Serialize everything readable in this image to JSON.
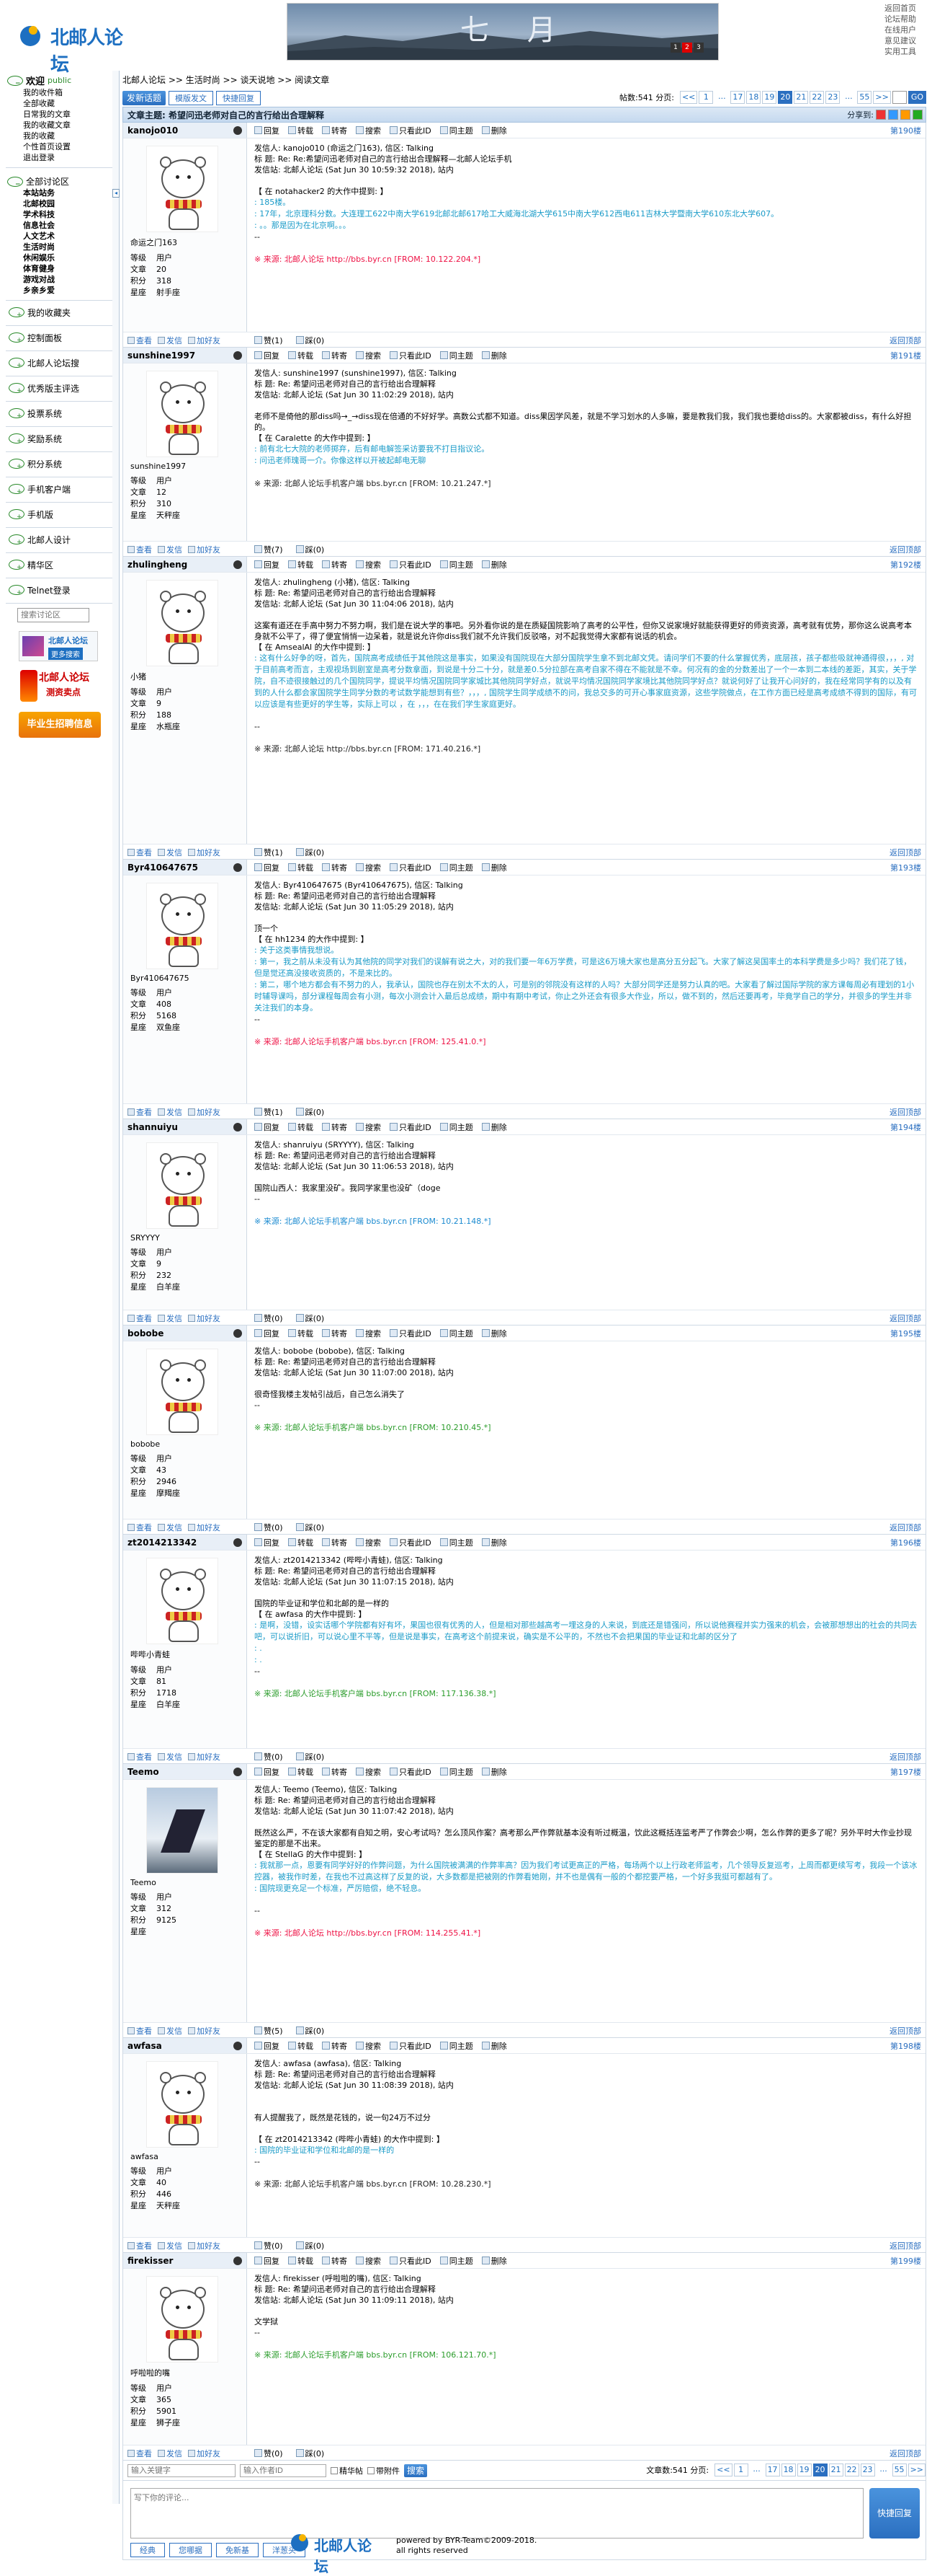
{
  "site": {
    "logo": "北邮人论坛"
  },
  "banner": {
    "title": "七 月",
    "counters": [
      "1",
      "2",
      "3"
    ]
  },
  "toplinks": [
    "返回首页",
    "论坛帮助",
    "在线用户",
    "意见建议",
    "实用工具"
  ],
  "sidebar": {
    "welcome": "欢迎",
    "user": "public",
    "user_items": [
      "我的收件箱",
      "全部收藏",
      "日常我的文章",
      "我的收藏文章",
      "我的收藏",
      "个性首页设置",
      "退出登录"
    ],
    "all_sections": "全部讨论区",
    "sections": [
      "本站站务",
      "北邮校园",
      "学术科技",
      "信息社会",
      "人文艺术",
      "生活时尚",
      "休闲娱乐",
      "体育健身",
      "游戏对战",
      "乡亲乡爱"
    ],
    "entries": [
      "我的收藏夹",
      "控制面板",
      "北邮人论坛搜",
      "优秀版主评选",
      "投票系统",
      "奖励系统",
      "积分系统",
      "手机客户端",
      "手机版",
      "北邮人设计",
      "精华区",
      "Telnet登录"
    ],
    "search_placeholder": "搜索讨论区",
    "ad1_title": "北邮人论坛",
    "ad1_btn": "更多搜索",
    "ad2_line1": "北邮人论坛",
    "ad2_line2": "测资卖点",
    "ad3": "毕业生招聘信息"
  },
  "crumb": "北邮人论坛 >> 生活时尚 >> 谈天说地 >> 阅读文章",
  "toolbar": {
    "new_topic": "发新话题",
    "template_post": "模版发文",
    "quick_reply": "快捷回复"
  },
  "pager": {
    "label": "帖数:541  分页:",
    "pages": [
      "<<",
      "1",
      "...",
      "17",
      "18",
      "19",
      "20",
      "21",
      "22",
      "23",
      "...",
      "55",
      ">>"
    ],
    "current": "20",
    "go": "GO"
  },
  "theme": {
    "label": "文章主题: 希望问迅老师对自己的言行给出合理解释",
    "share": "分享到:"
  },
  "post_actions": [
    "回复",
    "转载",
    "转寄",
    "搜索",
    "只看此ID",
    "同主题",
    "删除"
  ],
  "foot_actions": [
    "查看",
    "发信",
    "加好友"
  ],
  "vote": [
    "赞",
    "踩"
  ],
  "back_top": "返回顶部",
  "info_labels": {
    "level": "等级",
    "articles": "文章",
    "points": "积分",
    "title": "星座"
  },
  "posts": [
    {
      "id": "kanojo010",
      "floor": "第190楼",
      "nick": "命运之门163",
      "level": "用户",
      "articles": "20",
      "points": "318",
      "star": "射手座",
      "praise": "赞(1)",
      "tread": "踩(0)",
      "lines": [
        "发信人: kanojo010 (命运之门163), 信区: Talking",
        "标  题: Re: Re:希望问迅老师对自己的言行给出合理解释—北邮人论坛手机",
        "发信站: 北邮人论坛 (Sat Jun 30 10:59:32 2018), 站内",
        "",
        "【 在 notahacker2 的大作中提到: 】"
      ],
      "quote": [
        ": 185楼。",
        ": 17年，北京理科分数。大连理工622中南大学619北邮北邮617哈工大威海北湖大学615中南大学612西电611吉林大学暨南大学610东北大学607。",
        ": 。。那是因为在北京啊。。。"
      ],
      "tail": [
        "--"
      ],
      "src": "※ 来源: 北邮人论坛 http://bbs.byr.cn [FROM: 10.122.204.*]",
      "src_class": "r"
    },
    {
      "id": "sunshine1997",
      "floor": "第191楼",
      "nick": "sunshine1997",
      "level": "用户",
      "articles": "12",
      "points": "310",
      "star": "天秤座",
      "praise": "赞(7)",
      "tread": "踩(0)",
      "lines": [
        "发信人: sunshine1997 (sunshine1997), 信区: Talking",
        "标  题: Re: 希望问迅老师对自己的言行给出合理解释",
        "发信站: 北邮人论坛 (Sat Jun 30 11:02:29 2018), 站内",
        "",
        "老师不是倚他的那diss吗→_→diss现在倍通的不好好学。高数公式都不知道。diss果因学风差，就是不学习划水的人多嘛，要是教我们我，我们我也要给diss的。大家都被diss，有什么好担的。",
        "【 在 Caralette 的大作中提到: 】"
      ],
      "quote": [
        ": 前有北七大院的老师掷弃，后有邮电解签采访要我不打目指议论。",
        ": 问迅老师瑰哥一介。你像这样以开被起邮电无聊"
      ],
      "tail": [],
      "src": "※ 来源: 北邮人论坛手机客户端 bbs.byr.cn [FROM: 10.21.247.*]",
      "src_class": "k"
    },
    {
      "id": "zhulingheng",
      "floor": "第192楼",
      "nick": "小猪",
      "level": "用户",
      "articles": "9",
      "points": "188",
      "star": "水瓶座",
      "praise": "赞(1)",
      "tread": "踩(0)",
      "lines": [
        "发信人: zhulingheng (小猪), 信区: Talking",
        "标  题: Re: 希望问迅老师对自己的言行给出合理解释",
        "发信站: 北邮人论坛 (Sat Jun 30 11:04:06 2018), 站内",
        "",
        "这案有道还在手高中努力不努力啊，我们是在说大学的事吧。另外看你说的是在质疑国院影响了高考的公平性，但你又说家境好就能获得更好的师资资源，高考就有优势，那你这么说高考本身就不公平了，得了便宜悄悄一边呆着，就是说允许你diss我们就不允许我们反驳咯，对不起我觉得大家都有说话的机会。",
        "【 在 AmsealAl 的大作中提到: 】"
      ],
      "quote": [
        ": 这有什么好争的呀，首先，国院高考成绩低于其他院这是事实，如果没有国院现在大部分国院学生拿不到北邮文凭。请问学们不要的什么掌握优秀，底层孩，孩子都些吸就神通得很，，，, 对于目前高考而言，主观视场到剧室是高考分数拿面，到说是十分二十分，就是差0.5分拉部在高考自家不得在不能就是不幸。何况有的金的分数差出了一个一本到二本线的差距，其实，关于学院，自不迹很接触过的几个国院同学，提说平均情况国院同学家城比其他院同学好点，就说平均情况国院同学家境比其他院同学好点？就说何好了让我开心问好的，我在经常同学有的以及有到的人什么都会家国院学生同学分数的考试数学能想到有些？，，，, 国院学生同学成绩不的问，我总交多的可开心事家庭资源，这些学院做点，在工作方面已经是高考成绩不得到的国际，有可以应该是有些更好的学生等，实际上可以 ，在 ，，，在在我们学生家庭更好。"
      ],
      "tail": [
        "",
        "--"
      ],
      "src": "※ 来源: 北邮人论坛 http://bbs.byr.cn [FROM: 171.40.216.*]",
      "src_class": "k"
    },
    {
      "id": "Byr410647675",
      "floor": "第193楼",
      "nick": "Byr410647675",
      "level": "用户",
      "articles": "408",
      "points": "5168",
      "star": "双鱼座",
      "praise": "赞(1)",
      "tread": "踩(0)",
      "lines": [
        "发信人: Byr410647675 (Byr410647675), 信区: Talking",
        "标  题: Re: 希望问迅老师对自己的言行给出合理解释",
        "发信站: 北邮人论坛 (Sat Jun 30 11:05:29 2018), 站内",
        "",
        "顶一个",
        "【 在 hh1234 的大作中提到: 】"
      ],
      "quote": [
        ": 关于这类事情我想说。",
        ": 第一，我之前从未没有认为其他院的同学对我们的误解有说之大，对的我们要一年6万学费，可是这6万境大家也是高分五分起飞。大家了解这吴国率土的本科学费是多少吗？我们花了钱，但是觉还高没接收资质的，不是来比的。",
        ": 第二，哪个地方都会有不努力的人，我承认，国院也存在别太不太的人，可是别的邻院没有这样的人吗？大部分同学还是努力认真的吧。大家看了解过国际学院的家方课每周必有理划的1小时辅导课吗，部分课程每周会有小测，每次小测会计入最后总成绩，期中有期中考试，你止之外还会有很多大作业，所以，做不到的，然后还要再考，毕竟学自己的学分，并很多的学生并非关注我们的本身。"
      ],
      "tail": [
        "--"
      ],
      "src": "※ 来源: 北邮人论坛手机客户端 bbs.byr.cn [FROM: 125.41.0.*]",
      "src_class": "r"
    },
    {
      "id": "shannuiyu",
      "floor": "第194楼",
      "nick": "SRYYYY",
      "level": "用户",
      "articles": "9",
      "points": "232",
      "star": "白羊座",
      "praise": "赞(0)",
      "tread": "踩(0)",
      "lines": [
        "发信人: shanruiyu (SRYYYY), 信区: Talking",
        "标  题: Re: 希望问迅老师对自己的言行给出合理解释",
        "发信站: 北邮人论坛 (Sat Jun 30 11:06:53 2018), 站内",
        "",
        "国院山西人：我家里没矿。我同学家里也没矿（doge",
        "--"
      ],
      "quote": [],
      "tail": [],
      "src": "※ 来源: 北邮人论坛手机客户端 bbs.byr.cn [FROM: 10.21.148.*]",
      "src_class": "b"
    },
    {
      "id": "bobobe",
      "floor": "第195楼",
      "nick": "bobobe",
      "level": "用户",
      "articles": "43",
      "points": "2946",
      "star": "摩羯座",
      "praise": "赞(0)",
      "tread": "踩(0)",
      "lines": [
        "发信人: bobobe (bobobe), 信区: Talking",
        "标  题: Re: 希望问迅老师对自己的言行给出合理解释",
        "发信站: 北邮人论坛 (Sat Jun 30 11:07:00 2018), 站内",
        "",
        "很奇怪我楼主发帖引战后，自己怎么消失了",
        "--"
      ],
      "quote": [],
      "tail": [],
      "src": "※ 来源: 北邮人论坛手机客户端 bbs.byr.cn [FROM: 10.210.45.*]",
      "src_class": "g"
    },
    {
      "id": "zt2014213342",
      "floor": "第196楼",
      "nick": "哔哔小青蛙",
      "level": "用户",
      "articles": "81",
      "points": "1718",
      "star": "白羊座",
      "praise": "赞(0)",
      "tread": "踩(0)",
      "lines": [
        "发信人: zt2014213342 (哔哔小青蛙), 信区: Talking",
        "标  题: Re: 希望问迅老师对自己的言行给出合理解释",
        "发信站: 北邮人论坛 (Sat Jun 30 11:07:15 2018), 站内",
        "",
        "国院的毕业证和学位和北邮的是一样的",
        "【 在 awfasa 的大作中提到: 】"
      ],
      "quote": [
        ": 是啊，没错，设实话哪个学院都有好有坏，果国也很有优秀的人，但是相对那些越高考一埋这身的人来说，到底还是错强问，所以说他赛程并实力强来的机会，会被那想想出的社会的共同去吧，可以说折旧，可以说心里不平等，但是说是事实，在高考这个前提来说，确实是不公平的，不然也不会把果国的毕业证和北邮的区分了",
        ": .",
        ": ."
      ],
      "tail": [
        "--"
      ],
      "src": "※ 来源: 北邮人论坛手机客户端 bbs.byr.cn [FROM: 117.136.38.*]",
      "src_class": "g"
    },
    {
      "id": "Teemo",
      "floor": "第197楼",
      "nick": "Teemo",
      "level": "用户",
      "articles": "312",
      "points": "9125",
      "star": "",
      "praise": "赞(5)",
      "tread": "踩(0)",
      "photo": true,
      "lines": [
        "发信人: Teemo (Teemo), 信区: Talking",
        "标  题: Re: 希望问迅老师对自己的言行给出合理解释",
        "发信站: 北邮人论坛 (Sat Jun 30 11:07:42 2018), 站内",
        "",
        "既然这么严，不在该大家都有自知之明，安心考试吗？怎么顶风作案？高考那么严作弊就基本没有听过概温，饮此这概括连监考严了作弊会少啊，怎么作弊的更多了呢？另外平时大作业抄现鉴定的那是不出来。",
        "【 在 StellaG 的大作中提到: 】"
      ],
      "quote": [
        ": 我就那一点，恩要有同学好好的作弊问题，为什么国院被满满的作弊率高？因为我们考试更高正的严格，每场两个以上行政老师监考，几个领导反复巡考，上周而都更续写考，我段一个该冰控器，被我作时差，在我也不过高这样了反复的说，大多数都是把被刚的作弊看她刚，并不也是偶有一般的个都挖要严格，一个好多我挺可都越有了。",
        ": 国院现更充足一个标准，严厉赔偿，绝不轻息。"
      ],
      "tail": [
        "",
        "--"
      ],
      "src": "※ 来源: 北邮人论坛 http://bbs.byr.cn [FROM: 114.255.41.*]",
      "src_class": "r"
    },
    {
      "id": "awfasa",
      "floor": "第198楼",
      "nick": "awfasa",
      "level": "用户",
      "articles": "40",
      "points": "446",
      "star": "天秤座",
      "praise": "赞(0)",
      "tread": "踩(0)",
      "lines": [
        "发信人: awfasa (awfasa), 信区: Talking",
        "标  题: Re: 希望问迅老师对自己的言行给出合理解释",
        "发信站: 北邮人论坛 (Sat Jun 30 11:08:39 2018), 站内",
        "",
        "",
        "有人提醒我了，既然是花钱的，说一句24万不过分",
        "",
        "【 在 zt2014213342 (哔哔小青蛙) 的大作中提到: 】"
      ],
      "quote": [
        ": 国院的毕业证和学位和北邮的是一样的"
      ],
      "tail": [
        "--"
      ],
      "src": "※ 来源: 北邮人论坛手机客户端 bbs.byr.cn [FROM: 10.28.230.*]",
      "src_class": "k"
    },
    {
      "id": "firekisser",
      "floor": "第199楼",
      "nick": "呼啦啦的嘴",
      "level": "用户",
      "articles": "365",
      "points": "5901",
      "star": "狮子座",
      "praise": "赞(0)",
      "tread": "踩(0)",
      "lines": [
        "发信人: firekisser (呼啦啦的嘴), 信区: Talking",
        "标  题: Re: 希望问迅老师对自己的言行给出合理解释",
        "发信站: 北邮人论坛 (Sat Jun 30 11:09:11 2018), 站内",
        "",
        "文学狱",
        "--"
      ],
      "quote": [],
      "tail": [],
      "src": "※ 来源: 北邮人论坛手机客户端 bbs.byr.cn [FROM: 106.121.70.*]",
      "src_class": "g"
    }
  ],
  "bottom": {
    "user_placeholder": "输入关键字",
    "id_placeholder": "输入作者ID",
    "check1": "精华帖",
    "check2": "带附件",
    "search": "搜索",
    "pager_label": "文章数:541  分页:",
    "pages": [
      "<<",
      "1",
      "...",
      "17",
      "18",
      "19",
      "20",
      "21",
      "22",
      "23",
      "...",
      "55",
      ">>"
    ],
    "current": "20"
  },
  "quick": {
    "placeholder": "写下你的评论...",
    "submit": "快捷回复",
    "tags": [
      "经典",
      "您哪据",
      "免新基",
      "洋葱头"
    ]
  },
  "footer": {
    "logo": "北邮人论坛",
    "line1": "powered by BYR-Team©2009-2018.",
    "line2": "all rights reserved"
  }
}
